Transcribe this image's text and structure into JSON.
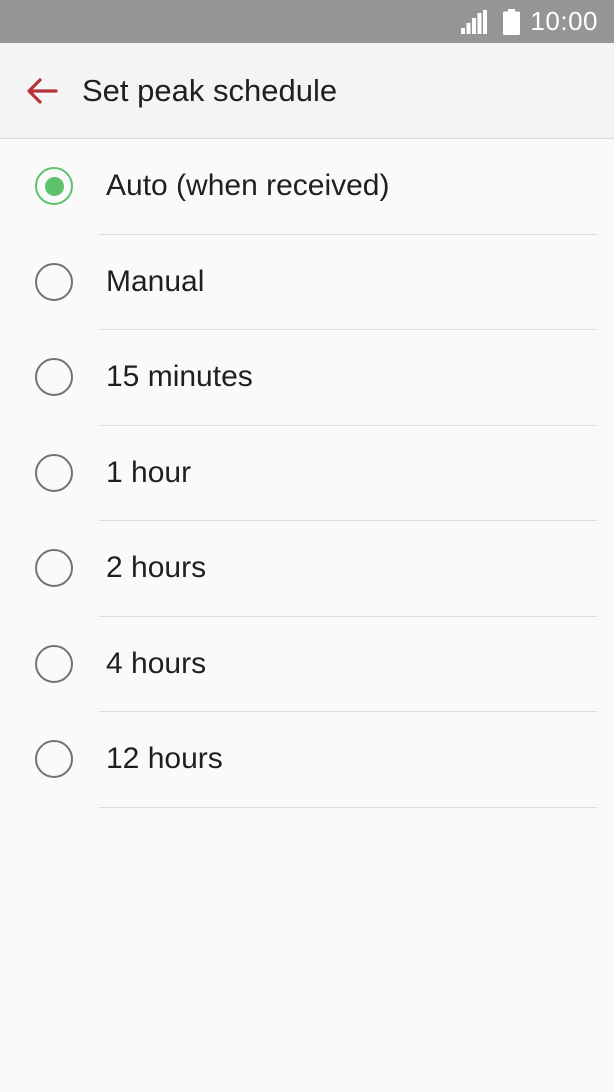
{
  "status_bar": {
    "time": "10:00",
    "icons": [
      "signal-icon",
      "battery-icon"
    ],
    "background_color": "#959595"
  },
  "app_bar": {
    "title": "Set peak schedule",
    "back_icon": "back-arrow-icon",
    "back_icon_color": "#b5343a"
  },
  "options": [
    {
      "label": "Auto (when received)",
      "selected": true
    },
    {
      "label": "Manual",
      "selected": false
    },
    {
      "label": "15 minutes",
      "selected": false
    },
    {
      "label": "1 hour",
      "selected": false
    },
    {
      "label": "2 hours",
      "selected": false
    },
    {
      "label": "4 hours",
      "selected": false
    },
    {
      "label": "12 hours",
      "selected": false
    }
  ],
  "colors": {
    "radio_selected": "#5cc26b",
    "radio_unselected": "#737373"
  }
}
